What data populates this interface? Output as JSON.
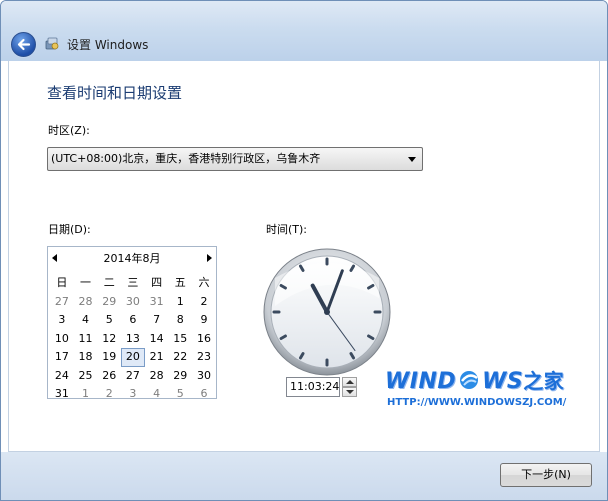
{
  "window": {
    "title": "设置 Windows",
    "back_icon": "back-arrow-icon",
    "app_icon": "setup-icon"
  },
  "page": {
    "heading": "查看时间和日期设置",
    "timezone_label": "时区(Z):",
    "timezone_value": "(UTC+08:00)北京，重庆，香港特别行政区，乌鲁木齐",
    "date_label": "日期(D):",
    "time_label": "时间(T):"
  },
  "calendar": {
    "month_title": "2014年8月",
    "weekdays": [
      "日",
      "一",
      "二",
      "三",
      "四",
      "五",
      "六"
    ],
    "weeks": [
      [
        {
          "d": "27",
          "o": true
        },
        {
          "d": "28",
          "o": true
        },
        {
          "d": "29",
          "o": true
        },
        {
          "d": "30",
          "o": true
        },
        {
          "d": "31",
          "o": true
        },
        {
          "d": "1",
          "o": false
        },
        {
          "d": "2",
          "o": false
        }
      ],
      [
        {
          "d": "3",
          "o": false
        },
        {
          "d": "4",
          "o": false
        },
        {
          "d": "5",
          "o": false
        },
        {
          "d": "6",
          "o": false
        },
        {
          "d": "7",
          "o": false
        },
        {
          "d": "8",
          "o": false
        },
        {
          "d": "9",
          "o": false
        }
      ],
      [
        {
          "d": "10",
          "o": false
        },
        {
          "d": "11",
          "o": false
        },
        {
          "d": "12",
          "o": false
        },
        {
          "d": "13",
          "o": false
        },
        {
          "d": "14",
          "o": false
        },
        {
          "d": "15",
          "o": false
        },
        {
          "d": "16",
          "o": false
        }
      ],
      [
        {
          "d": "17",
          "o": false
        },
        {
          "d": "18",
          "o": false
        },
        {
          "d": "19",
          "o": false
        },
        {
          "d": "20",
          "o": false,
          "selected": true
        },
        {
          "d": "21",
          "o": false
        },
        {
          "d": "22",
          "o": false
        },
        {
          "d": "23",
          "o": false
        }
      ],
      [
        {
          "d": "24",
          "o": false
        },
        {
          "d": "25",
          "o": false
        },
        {
          "d": "26",
          "o": false
        },
        {
          "d": "27",
          "o": false
        },
        {
          "d": "28",
          "o": false
        },
        {
          "d": "29",
          "o": false
        },
        {
          "d": "30",
          "o": false
        }
      ],
      [
        {
          "d": "31",
          "o": false
        },
        {
          "d": "1",
          "o": true
        },
        {
          "d": "2",
          "o": true
        },
        {
          "d": "3",
          "o": true
        },
        {
          "d": "4",
          "o": true
        },
        {
          "d": "5",
          "o": true
        },
        {
          "d": "6",
          "o": true
        }
      ]
    ]
  },
  "clock": {
    "time_value": "11:03:24",
    "hour": 11,
    "minute": 3,
    "second": 24
  },
  "watermark": {
    "logo_text": "WIND",
    "logo_mid": "WS",
    "logo_cn": "之家",
    "url": "HTTP://WWW.WINDOWSZJ.COM/"
  },
  "footer": {
    "next_label": "下一步(N)"
  },
  "colors": {
    "heading": "#1b3c72",
    "watermark": "#1d6fd8",
    "selected_day_bg": "#dfe9f7"
  }
}
